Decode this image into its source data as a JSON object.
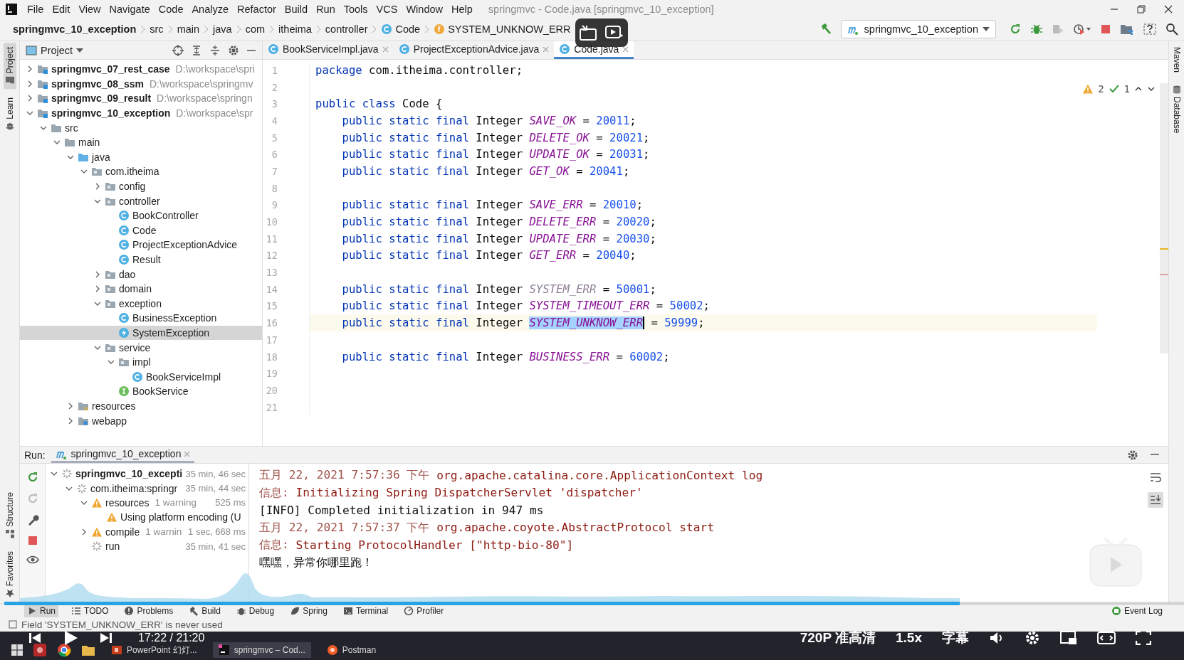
{
  "window": {
    "title": "springmvc - Code.java [springmvc_10_exception]"
  },
  "menu": [
    "File",
    "Edit",
    "View",
    "Navigate",
    "Code",
    "Analyze",
    "Refactor",
    "Build",
    "Run",
    "Tools",
    "VCS",
    "Window",
    "Help"
  ],
  "breadcrumbs": [
    {
      "label": "springmvc_10_exception",
      "kind": "project"
    },
    {
      "label": "src",
      "kind": "plain"
    },
    {
      "label": "main",
      "kind": "plain"
    },
    {
      "label": "java",
      "kind": "plain"
    },
    {
      "label": "com",
      "kind": "plain"
    },
    {
      "label": "itheima",
      "kind": "plain"
    },
    {
      "label": "controller",
      "kind": "plain"
    },
    {
      "label": "Code",
      "kind": "class"
    },
    {
      "label": "SYSTEM_UNKNOW_ERR",
      "kind": "field"
    }
  ],
  "run_config": {
    "label": "springmvc_10_exception"
  },
  "side_tools": {
    "left_top": [
      {
        "label": "Project",
        "selected": true
      },
      {
        "label": "Learn",
        "selected": false
      }
    ],
    "left_bottom": [
      {
        "label": "Structure",
        "selected": false
      },
      {
        "label": "Favorites",
        "selected": false
      }
    ],
    "right": [
      {
        "label": "Maven",
        "selected": false
      },
      {
        "label": "Database",
        "selected": false
      }
    ]
  },
  "project_panel": {
    "title": "Project",
    "tree": [
      {
        "label": "springmvc_07_rest_case",
        "path": "D:\\workspace\\spri",
        "kind": "module",
        "expanded": false,
        "selected": false
      },
      {
        "label": "springmvc_08_ssm",
        "path": "D:\\workspace\\springmv",
        "kind": "module",
        "expanded": false,
        "selected": false
      },
      {
        "label": "springmvc_09_result",
        "path": "D:\\workspace\\springn",
        "kind": "module",
        "expanded": false,
        "selected": false
      },
      {
        "label": "springmvc_10_exception",
        "path": "D:\\workspace\\spr",
        "kind": "module",
        "expanded": true,
        "selected": false,
        "children": [
          {
            "label": "src",
            "kind": "folder",
            "expanded": true,
            "selected": false,
            "children": [
              {
                "label": "main",
                "kind": "folder",
                "expanded": true,
                "selected": false,
                "children": [
                  {
                    "label": "java",
                    "kind": "source",
                    "expanded": true,
                    "selected": false,
                    "children": [
                      {
                        "label": "com.itheima",
                        "kind": "package",
                        "expanded": true,
                        "selected": false,
                        "children": [
                          {
                            "label": "config",
                            "kind": "package",
                            "expanded": false,
                            "selected": false
                          },
                          {
                            "label": "controller",
                            "kind": "package",
                            "expanded": true,
                            "selected": false,
                            "children": [
                              {
                                "label": "BookController",
                                "kind": "class",
                                "selected": false
                              },
                              {
                                "label": "Code",
                                "kind": "class",
                                "selected": false
                              },
                              {
                                "label": "ProjectExceptionAdvice",
                                "kind": "class",
                                "selected": false
                              },
                              {
                                "label": "Result",
                                "kind": "class",
                                "selected": false
                              }
                            ]
                          },
                          {
                            "label": "dao",
                            "kind": "package",
                            "expanded": false,
                            "selected": false
                          },
                          {
                            "label": "domain",
                            "kind": "package",
                            "expanded": false,
                            "selected": false
                          },
                          {
                            "label": "exception",
                            "kind": "package",
                            "expanded": true,
                            "selected": false,
                            "children": [
                              {
                                "label": "BusinessException",
                                "kind": "class",
                                "selected": false
                              },
                              {
                                "label": "SystemException",
                                "kind": "exception",
                                "selected": true
                              }
                            ]
                          },
                          {
                            "label": "service",
                            "kind": "package",
                            "expanded": true,
                            "selected": false,
                            "children": [
                              {
                                "label": "impl",
                                "kind": "package",
                                "expanded": true,
                                "selected": false,
                                "children": [
                                  {
                                    "label": "BookServiceImpl",
                                    "kind": "class",
                                    "selected": false
                                  }
                                ]
                              },
                              {
                                "label": "BookService",
                                "kind": "interface",
                                "selected": false
                              }
                            ]
                          }
                        ]
                      }
                    ]
                  },
                  {
                    "label": "resources",
                    "kind": "resources",
                    "expanded": false,
                    "selected": false
                  },
                  {
                    "label": "webapp",
                    "kind": "web",
                    "expanded": false,
                    "selected": false
                  }
                ]
              }
            ]
          }
        ]
      }
    ]
  },
  "editor_tabs": [
    {
      "label": "BookServiceImpl.java",
      "selected": false
    },
    {
      "label": "ProjectExceptionAdvice.java",
      "selected": false
    },
    {
      "label": "Code.java",
      "selected": true
    }
  ],
  "editor": {
    "warnings": "2",
    "checks": "1",
    "lines": [
      {
        "number": "1",
        "current": false,
        "tokens": [
          {
            "text": "package",
            "kind": "keyword"
          },
          {
            "text": " com.itheima.controller;",
            "kind": "plain"
          }
        ]
      },
      {
        "number": "2",
        "current": false
      },
      {
        "number": "3",
        "current": false,
        "tokens": [
          {
            "text": "public class",
            "kind": "keyword"
          },
          {
            "text": " Code {",
            "kind": "plain"
          }
        ]
      },
      {
        "number": "4",
        "current": false,
        "tokens": [
          {
            "text": "    public static final",
            "kind": "keyword"
          },
          {
            "text": " Integer ",
            "kind": "plain"
          },
          {
            "text": "SAVE_OK",
            "kind": "constant"
          },
          {
            "text": " = ",
            "kind": "plain"
          },
          {
            "text": "20011",
            "kind": "number"
          },
          {
            "text": ";",
            "kind": "plain"
          }
        ]
      },
      {
        "number": "5",
        "current": false,
        "tokens": [
          {
            "text": "    public static final",
            "kind": "keyword"
          },
          {
            "text": " Integer ",
            "kind": "plain"
          },
          {
            "text": "DELETE_OK",
            "kind": "constant"
          },
          {
            "text": " = ",
            "kind": "plain"
          },
          {
            "text": "20021",
            "kind": "number"
          },
          {
            "text": ";",
            "kind": "plain"
          }
        ]
      },
      {
        "number": "6",
        "current": false,
        "tokens": [
          {
            "text": "    public static final",
            "kind": "keyword"
          },
          {
            "text": " Integer ",
            "kind": "plain"
          },
          {
            "text": "UPDATE_OK",
            "kind": "constant"
          },
          {
            "text": " = ",
            "kind": "plain"
          },
          {
            "text": "20031",
            "kind": "number"
          },
          {
            "text": ";",
            "kind": "plain"
          }
        ]
      },
      {
        "number": "7",
        "current": false,
        "tokens": [
          {
            "text": "    public static final",
            "kind": "keyword"
          },
          {
            "text": " Integer ",
            "kind": "plain"
          },
          {
            "text": "GET_OK",
            "kind": "constant"
          },
          {
            "text": " = ",
            "kind": "plain"
          },
          {
            "text": "20041",
            "kind": "number"
          },
          {
            "text": ";",
            "kind": "plain"
          }
        ]
      },
      {
        "number": "8",
        "current": false
      },
      {
        "number": "9",
        "current": false,
        "tokens": [
          {
            "text": "    public static final",
            "kind": "keyword"
          },
          {
            "text": " Integer ",
            "kind": "plain"
          },
          {
            "text": "SAVE_ERR",
            "kind": "constant"
          },
          {
            "text": " = ",
            "kind": "plain"
          },
          {
            "text": "20010",
            "kind": "number"
          },
          {
            "text": ";",
            "kind": "plain"
          }
        ]
      },
      {
        "number": "10",
        "current": false,
        "tokens": [
          {
            "text": "    public static final",
            "kind": "keyword"
          },
          {
            "text": " Integer ",
            "kind": "plain"
          },
          {
            "text": "DELETE_ERR",
            "kind": "constant"
          },
          {
            "text": " = ",
            "kind": "plain"
          },
          {
            "text": "20020",
            "kind": "number"
          },
          {
            "text": ";",
            "kind": "plain"
          }
        ]
      },
      {
        "number": "11",
        "current": false,
        "tokens": [
          {
            "text": "    public static final",
            "kind": "keyword"
          },
          {
            "text": " Integer ",
            "kind": "plain"
          },
          {
            "text": "UPDATE_ERR",
            "kind": "constant"
          },
          {
            "text": " = ",
            "kind": "plain"
          },
          {
            "text": "20030",
            "kind": "number"
          },
          {
            "text": ";",
            "kind": "plain"
          }
        ]
      },
      {
        "number": "12",
        "current": false,
        "tokens": [
          {
            "text": "    public static final",
            "kind": "keyword"
          },
          {
            "text": " Integer ",
            "kind": "plain"
          },
          {
            "text": "GET_ERR",
            "kind": "constant"
          },
          {
            "text": " = ",
            "kind": "plain"
          },
          {
            "text": "20040",
            "kind": "number"
          },
          {
            "text": ";",
            "kind": "plain"
          }
        ]
      },
      {
        "number": "13",
        "current": false
      },
      {
        "number": "14",
        "current": false,
        "tokens": [
          {
            "text": "    public static final",
            "kind": "keyword"
          },
          {
            "text": " Integer ",
            "kind": "plain"
          },
          {
            "text": "SYSTEM_ERR",
            "kind": "unused"
          },
          {
            "text": " = ",
            "kind": "plain"
          },
          {
            "text": "50001",
            "kind": "number"
          },
          {
            "text": ";",
            "kind": "plain"
          }
        ]
      },
      {
        "number": "15",
        "current": false,
        "tokens": [
          {
            "text": "    public static final",
            "kind": "keyword"
          },
          {
            "text": " Integer ",
            "kind": "plain"
          },
          {
            "text": "SYSTEM_TIMEOUT_ERR",
            "kind": "constant"
          },
          {
            "text": " = ",
            "kind": "plain"
          },
          {
            "text": "50002",
            "kind": "number"
          },
          {
            "text": ";",
            "kind": "plain"
          }
        ]
      },
      {
        "number": "16",
        "current": true,
        "tokens": [
          {
            "text": "    public static final",
            "kind": "keyword"
          },
          {
            "text": " Integer ",
            "kind": "plain"
          },
          {
            "text": "SYSTEM_UNKNOW_ERR",
            "kind": "selection"
          },
          {
            "text": " = ",
            "kind": "plain"
          },
          {
            "text": "59999",
            "kind": "number"
          },
          {
            "text": ";",
            "kind": "plain"
          }
        ]
      },
      {
        "number": "17",
        "current": false
      },
      {
        "number": "18",
        "current": false,
        "tokens": [
          {
            "text": "    public static final",
            "kind": "keyword"
          },
          {
            "text": " Integer ",
            "kind": "plain"
          },
          {
            "text": "BUSINESS_ERR",
            "kind": "constant"
          },
          {
            "text": " = ",
            "kind": "plain"
          },
          {
            "text": "60002",
            "kind": "number"
          },
          {
            "text": ";",
            "kind": "plain"
          }
        ]
      },
      {
        "number": "19",
        "current": false
      },
      {
        "number": "20",
        "current": false
      },
      {
        "number": "21",
        "current": false
      }
    ]
  },
  "run_panel": {
    "label": "Run:",
    "tab": "springmvc_10_exception",
    "tree": [
      {
        "label": "springmvc_10_excepti",
        "time": "35 min, 46 sec",
        "kind": "spinner",
        "expanded": true,
        "children": [
          {
            "label": "com.itheima:springr",
            "time": "35 min, 44 sec",
            "kind": "spinner",
            "expanded": true,
            "children": [
              {
                "label": "resources",
                "detail": "1 warning",
                "time": "525 ms",
                "kind": "warning",
                "expanded": true,
                "children": [
                  {
                    "label": "Using platform encoding (U",
                    "kind": "warning"
                  }
                ]
              },
              {
                "label": "compile",
                "detail": "1 warnin",
                "time": "1 sec, 668 ms",
                "kind": "warning",
                "expanded": false
              },
              {
                "label": "run",
                "time": "35 min, 41 sec",
                "kind": "spinner"
              }
            ]
          }
        ]
      }
    ],
    "console": [
      [
        {
          "text": "五月 22, 2021 7:57:36 下午 ",
          "kind": "meta"
        },
        {
          "text": "org.apache.catalina.core.ApplicationContext log",
          "kind": "log"
        }
      ],
      [
        {
          "text": "信息: ",
          "kind": "meta"
        },
        {
          "text": "Initializing Spring DispatcherServlet 'dispatcher'",
          "kind": "log"
        }
      ],
      [
        {
          "text": "[INFO] Completed initialization in 947 ms",
          "kind": "plain"
        }
      ],
      [
        {
          "text": "五月 22, 2021 7:57:37 下午 ",
          "kind": "meta"
        },
        {
          "text": "org.apache.coyote.AbstractProtocol start",
          "kind": "log"
        }
      ],
      [
        {
          "text": "信息: ",
          "kind": "meta"
        },
        {
          "text": "Starting ProtocolHandler [\"http-bio-80\"]",
          "kind": "log"
        }
      ],
      [
        {
          "text": "嘿嘿，异常你哪里跑！",
          "kind": "plain"
        }
      ]
    ]
  },
  "tool_tabs": [
    {
      "label": "Run",
      "kind": "run",
      "selected": true
    },
    {
      "label": "TODO",
      "kind": "todo",
      "selected": false
    },
    {
      "label": "Problems",
      "kind": "problems",
      "selected": false
    },
    {
      "label": "Build",
      "kind": "build",
      "selected": false
    },
    {
      "label": "Debug",
      "kind": "debug",
      "selected": false
    },
    {
      "label": "Spring",
      "kind": "spring",
      "selected": false
    },
    {
      "label": "Terminal",
      "kind": "terminal",
      "selected": false
    },
    {
      "label": "Profiler",
      "kind": "profiler",
      "selected": false
    }
  ],
  "event_log": "Event Log",
  "status": "Field 'SYSTEM_UNKNOW_ERR' is never used",
  "taskbar": [
    {
      "label": "PowerPoint 幻灯...",
      "kind": "powerpoint",
      "selected": false
    },
    {
      "label": "springmvc – Cod...",
      "kind": "intellij",
      "selected": true
    },
    {
      "label": "Postman",
      "kind": "postman",
      "selected": false
    }
  ],
  "player": {
    "progress": {
      "level": 0.81
    },
    "time": "17:22 / 21:20",
    "quality": "720P 准高清",
    "speed": "1.5x",
    "subtitles": "字幕"
  }
}
